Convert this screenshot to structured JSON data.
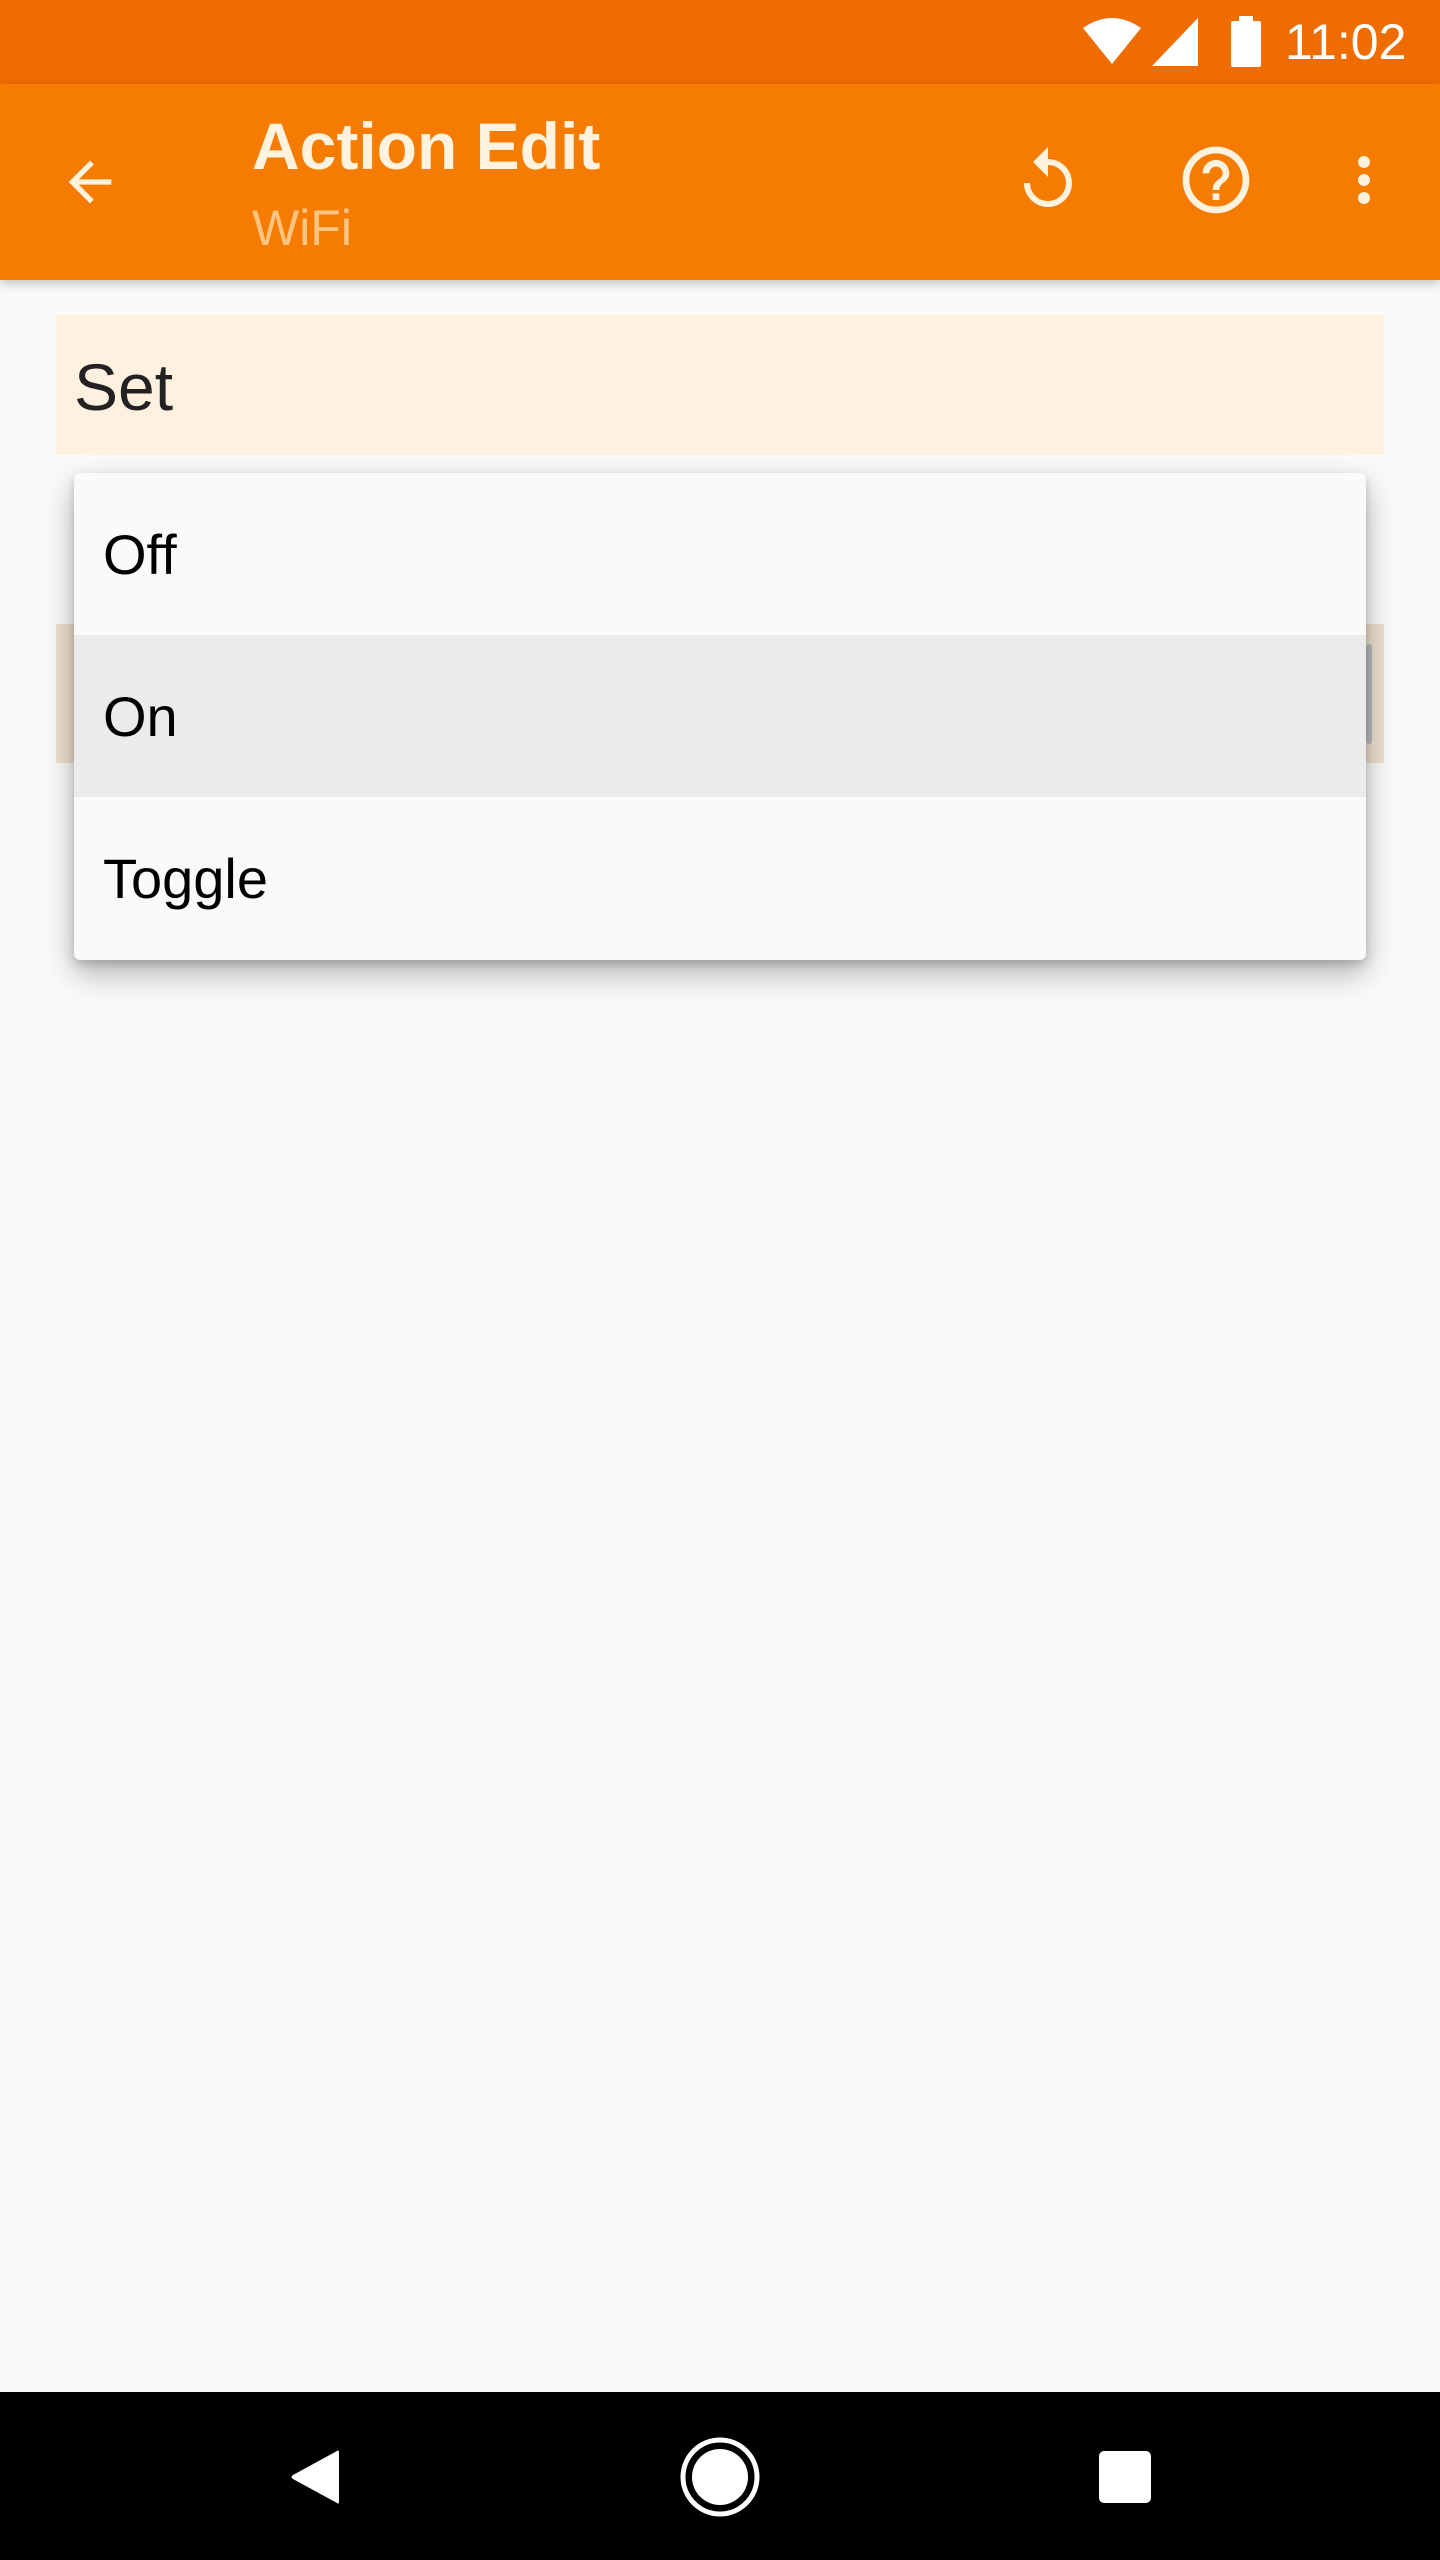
{
  "status_bar": {
    "time": "11:02",
    "icons": [
      "wifi-icon",
      "cell-signal-icon",
      "battery-icon"
    ]
  },
  "toolbar": {
    "title": "Action Edit",
    "subtitle": "WiFi",
    "actions": [
      "back-arrow-icon",
      "undo-icon",
      "help-icon",
      "more-vert-icon"
    ]
  },
  "form": {
    "set_label": "Set"
  },
  "dropdown": {
    "selected": "On",
    "options": [
      {
        "label": "Off"
      },
      {
        "label": "On"
      },
      {
        "label": "Toggle"
      }
    ]
  },
  "nav_bar": {
    "icons": [
      "nav-back-icon",
      "nav-home-icon",
      "nav-recents-icon"
    ]
  },
  "colors": {
    "status_bar": "#EF6C00",
    "toolbar": "#F57C00",
    "field_bg": "#FFF1E0",
    "selected_item": "#EBEBEB"
  }
}
